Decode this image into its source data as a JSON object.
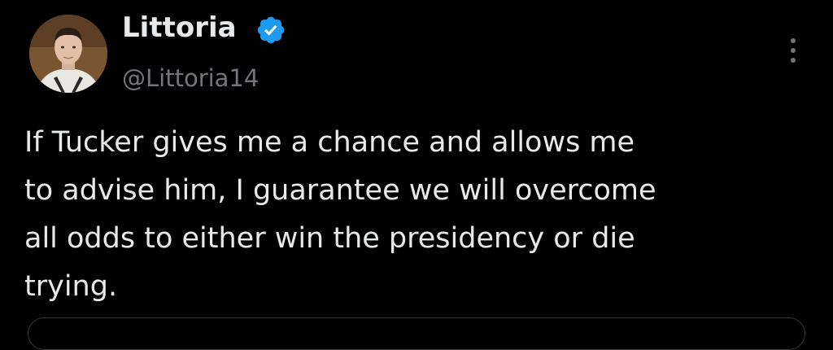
{
  "author": {
    "display_name": "Littoria",
    "handle": "@Littoria14",
    "verified": true
  },
  "tweet": {
    "lines": [
      "If Tucker gives me a chance and allows me",
      "to advise him, I guarantee we will overcome",
      "all odds to either win the presidency or die",
      "trying."
    ]
  },
  "icons": {
    "verified": "verified-badge-icon",
    "more": "more-vertical-icon"
  },
  "colors": {
    "background": "#000000",
    "text_primary": "#e7e9ea",
    "text_secondary": "#71767b",
    "verified_blue": "#1d9bf0",
    "border": "#2f3336"
  }
}
